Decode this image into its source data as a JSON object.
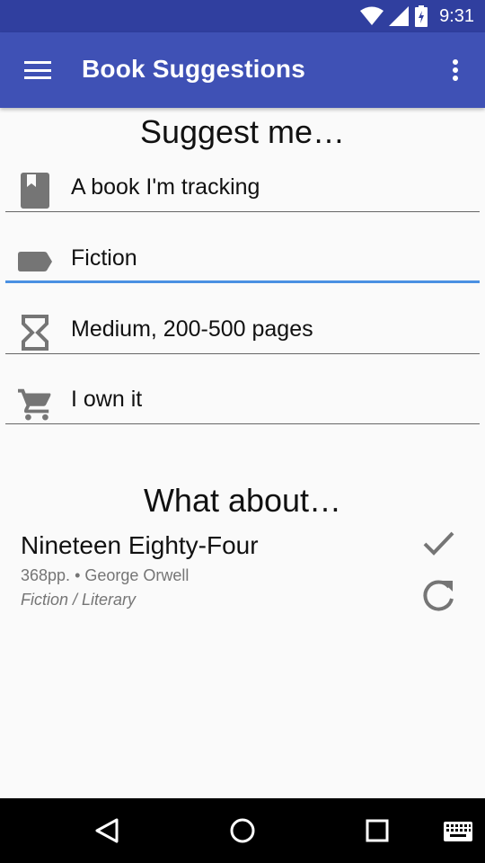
{
  "status_bar": {
    "time": "9:31"
  },
  "app_bar": {
    "title": "Book Suggestions"
  },
  "suggest_heading": "Suggest me…",
  "fields": [
    {
      "icon": "book-icon",
      "value": "A book I'm tracking"
    },
    {
      "icon": "tag-icon",
      "value": "Fiction"
    },
    {
      "icon": "hourglass-icon",
      "value": "Medium, 200-500 pages"
    },
    {
      "icon": "cart-icon",
      "value": "I own it"
    }
  ],
  "result_heading": "What about…",
  "book": {
    "title": "Nineteen Eighty-Four",
    "pages": "368pp.",
    "separator": "•",
    "author": "George Orwell",
    "genre": "Fiction / Literary"
  },
  "colors": {
    "primary": "#3f51b5",
    "primary_dark": "#303f9f",
    "accent": "#4a90e2"
  }
}
